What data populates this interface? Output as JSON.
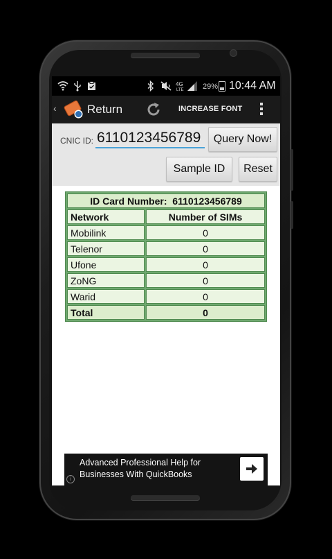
{
  "status_bar": {
    "battery_percent": "29%",
    "time": "10:44 AM",
    "icons": [
      "wifi-icon",
      "usb-icon",
      "clipboard-icon",
      "bluetooth-icon",
      "mute-icon",
      "lte-icon",
      "signal-icon",
      "battery-icon"
    ]
  },
  "action_bar": {
    "title": "Return",
    "increase_font_label": "INCREASE FONT",
    "icons": [
      "back-chevron-icon",
      "app-logo-icon",
      "refresh-icon",
      "overflow-menu-icon"
    ]
  },
  "form": {
    "cnic_label": "CNIC ID:",
    "cnic_value": "6110123456789",
    "query_button": "Query Now!",
    "sample_button": "Sample ID",
    "reset_button": "Reset"
  },
  "table": {
    "id_label": "ID Card Number:",
    "id_value": "6110123456789",
    "headers": [
      "Network",
      "Number of SIMs"
    ],
    "rows": [
      {
        "network": "Mobilink",
        "count": "0"
      },
      {
        "network": "Telenor",
        "count": "0"
      },
      {
        "network": "Ufone",
        "count": "0"
      },
      {
        "network": "ZoNG",
        "count": "0"
      },
      {
        "network": "Warid",
        "count": "0"
      }
    ],
    "total": {
      "label": "Total",
      "count": "0"
    }
  },
  "ad": {
    "line1": "Advanced Professional Help for",
    "line2": "Businesses With QuickBooks",
    "info": "i"
  },
  "colors": {
    "table_border": "#4f8a4f",
    "table_cell": "#ebf5e2",
    "input_underline": "#4aa3d8",
    "action_bar": "#1a1a1a"
  }
}
